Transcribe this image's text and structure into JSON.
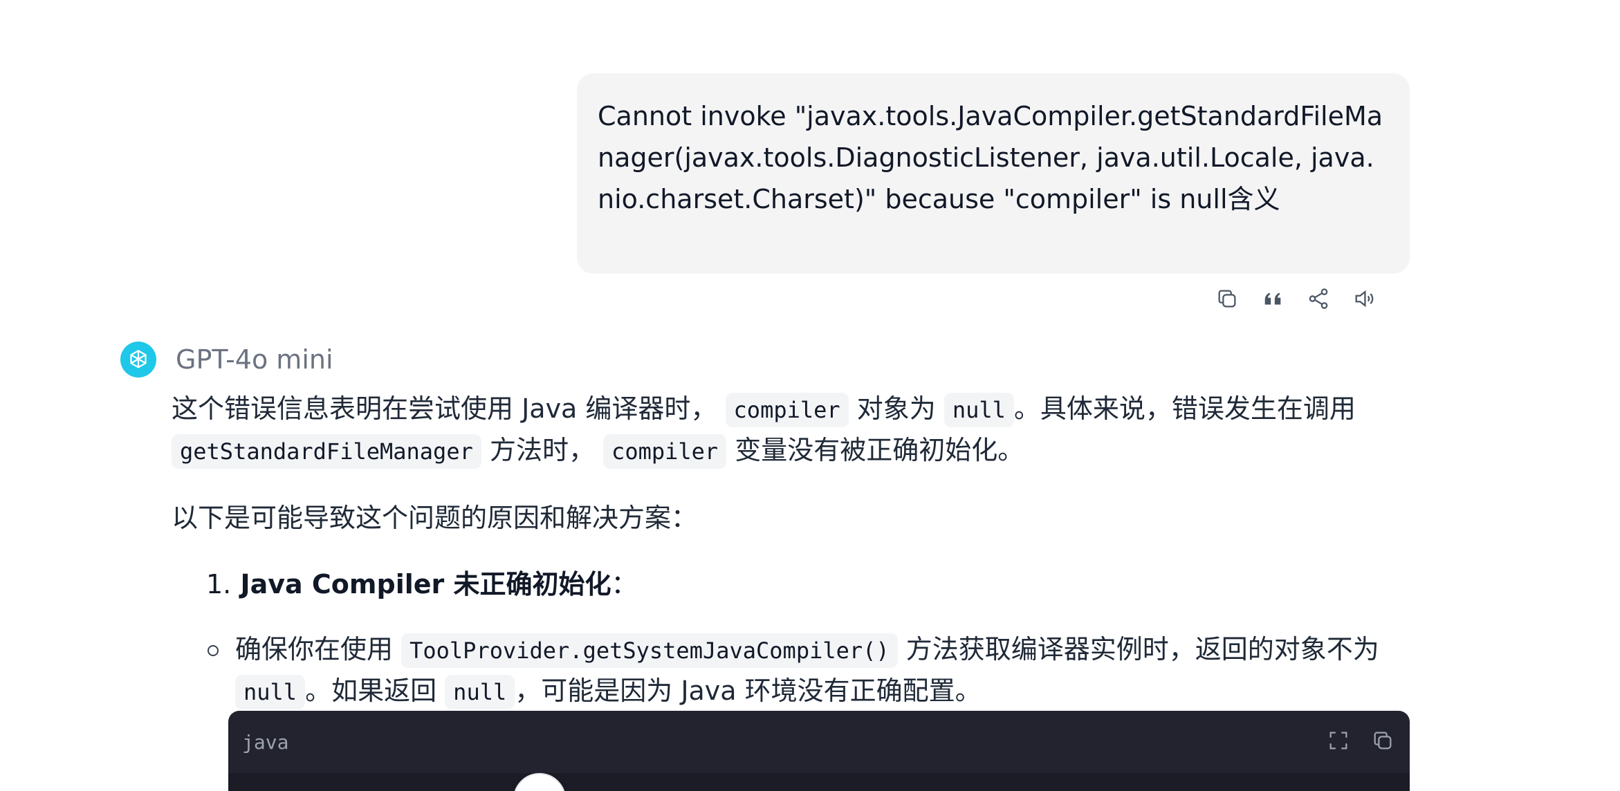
{
  "user_message": {
    "text": "Cannot invoke \"javax.tools.JavaCompiler.getStandardFileManager(javax.tools.DiagnosticListener, java.util.Locale, java.nio.charset.Charset)\" because \"compiler\" is null含义"
  },
  "user_actions": {
    "copy_icon": "copy-icon",
    "quote_icon": "quote-icon",
    "share_icon": "share-icon",
    "speak_icon": "speaker-icon"
  },
  "assistant": {
    "model_name": "GPT-4o mini",
    "avatar_color": "#1fc7e8",
    "para1": {
      "t1": "这个错误信息表明在尝试使用 Java 编译器时，",
      "c1": "compiler",
      "t2": "对象为",
      "c2": "null",
      "t3": "。具体来说，错误发生在调用",
      "c3": "getStandardFileManager",
      "t4": "方法时，",
      "c4": "compiler",
      "t5": "变量没有被正确初始化。"
    },
    "para2": "以下是可能导致这个问题的原因和解决方案：",
    "list": [
      {
        "number": "1.",
        "title": "Java Compiler 未正确初始化",
        "suffix": "：",
        "bullet": {
          "t1": "确保你在使用",
          "c1": "ToolProvider.getSystemJavaCompiler()",
          "t2": "方法获取编译器实例时，返回的对象不为",
          "c2": "null",
          "t3": "。如果返回",
          "c3": "null",
          "t4": "，可能是因为 Java 环境没有正确配置。"
        }
      }
    ],
    "code_block": {
      "language": "java"
    }
  }
}
